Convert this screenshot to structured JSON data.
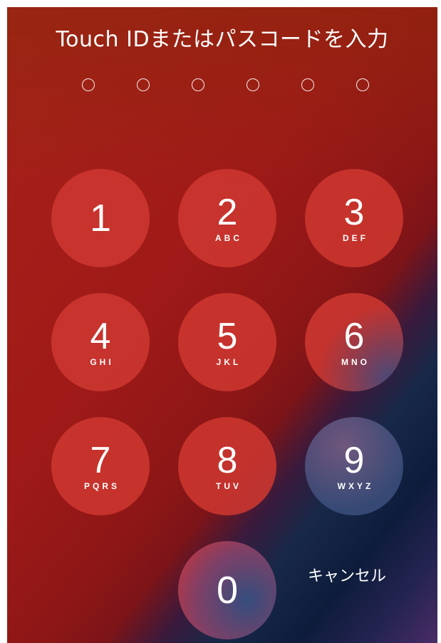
{
  "prompt": "Touch IDまたはパスコードを入力",
  "passcode_length": 6,
  "keys": [
    {
      "digit": "1",
      "letters": ""
    },
    {
      "digit": "2",
      "letters": "ABC"
    },
    {
      "digit": "3",
      "letters": "DEF"
    },
    {
      "digit": "4",
      "letters": "GHI"
    },
    {
      "digit": "5",
      "letters": "JKL"
    },
    {
      "digit": "6",
      "letters": "MNO"
    },
    {
      "digit": "7",
      "letters": "PQRS"
    },
    {
      "digit": "8",
      "letters": "TUV"
    },
    {
      "digit": "9",
      "letters": "WXYZ"
    },
    {
      "digit": "0",
      "letters": ""
    }
  ],
  "cancel_label": "キャンセル",
  "colors": {
    "key_fill": "#cd3730",
    "background_top": "#a8221a",
    "background_bottom_right": "#0e1c3c"
  }
}
